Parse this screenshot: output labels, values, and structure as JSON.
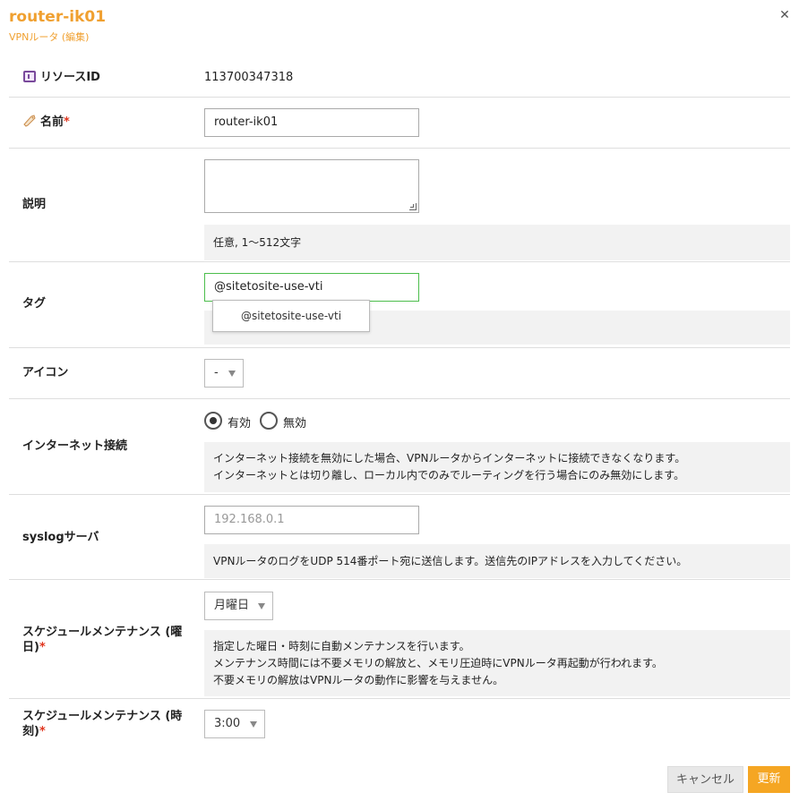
{
  "header": {
    "title": "router-ik01",
    "subtitle": "VPNルータ (編集)",
    "close_icon": "close-icon"
  },
  "fields": {
    "resource_id": {
      "label": "リソースID",
      "value": "113700347318",
      "icon": "id-card-icon"
    },
    "name": {
      "label": "名前",
      "required_mark": "*",
      "value": "router-ik01",
      "icon": "tag-icon"
    },
    "description": {
      "label": "説明",
      "value": "",
      "help": "任意, 1〜512文字"
    },
    "tags": {
      "label": "タグ",
      "value": "@sitetosite-use-vti",
      "suggestion": "@sitetosite-use-vti"
    },
    "icon": {
      "label": "アイコン",
      "selected": "-"
    },
    "internet": {
      "label": "インターネット接続",
      "options": [
        "有効",
        "無効"
      ],
      "selected": "有効",
      "help_lines": [
        "インターネット接続を無効にした場合、VPNルータからインターネットに接続できなくなります。",
        "インターネットとは切り離し、ローカル内でのみでルーティングを行う場合にのみ無効にします。"
      ]
    },
    "syslog": {
      "label": "syslogサーバ",
      "placeholder": "192.168.0.1",
      "help": "VPNルータのログをUDP 514番ポート宛に送信します。送信先のIPアドレスを入力してください。"
    },
    "maintenance_day": {
      "label_line1": "スケジュールメンテナンス (曜",
      "label_line2": "日)",
      "required_mark": "*",
      "selected": "月曜日",
      "help_lines": [
        "指定した曜日・時刻に自動メンテナンスを行います。",
        "メンテナンス時間には不要メモリの解放と、メモリ圧迫時にVPNルータ再起動が行われます。",
        "不要メモリの解放はVPNルータの動作に影響を与えません。"
      ]
    },
    "maintenance_time": {
      "label_line1": "スケジュールメンテナンス (時",
      "label_line2": "刻)",
      "required_mark": "*",
      "selected": "3:00"
    }
  },
  "footer": {
    "cancel_label": "キャンセル",
    "update_label": "更新"
  },
  "colors": {
    "accent": "#f0a030",
    "update_button": "#f5a623",
    "required": "#e0341d",
    "focus_border": "#4cbe4c"
  }
}
